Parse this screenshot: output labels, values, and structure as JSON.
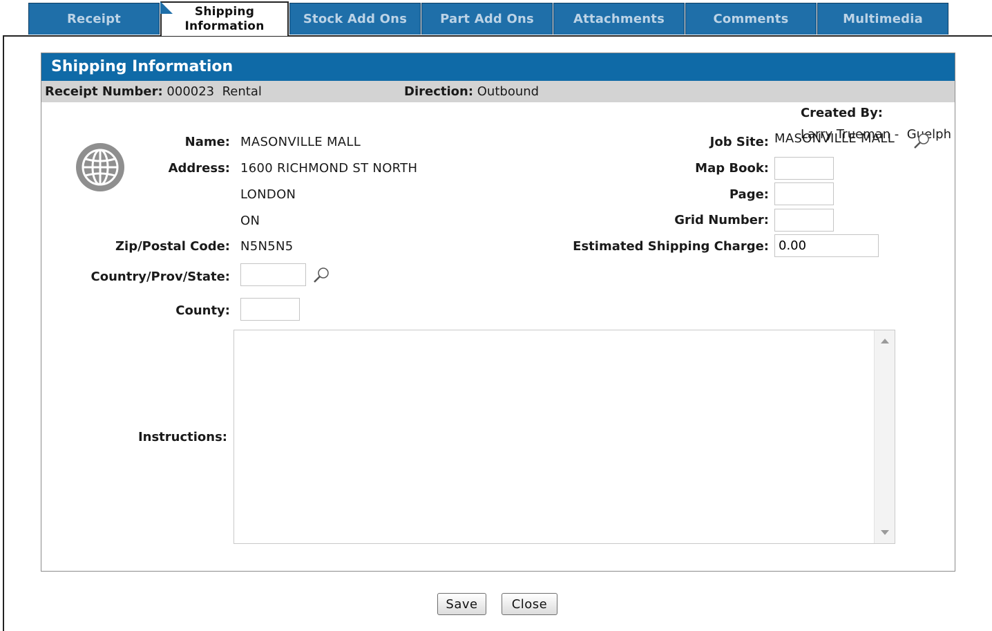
{
  "tabs": [
    {
      "label": "Receipt"
    },
    {
      "label": "Shipping Information"
    },
    {
      "label": "Stock Add Ons"
    },
    {
      "label": "Part Add Ons"
    },
    {
      "label": "Attachments"
    },
    {
      "label": "Comments"
    },
    {
      "label": "Multimedia"
    }
  ],
  "active_tab": "Shipping Information",
  "panel": {
    "title": "Shipping Information"
  },
  "infobar": {
    "receipt_label": "Receipt Number:",
    "receipt_value": "000023",
    "receipt_type": "Rental",
    "direction_label": "Direction:",
    "direction_value": "Outbound",
    "created_label": "Created By:",
    "created_value": "Larry Trueman -  Guelph"
  },
  "form": {
    "name_label": "Name:",
    "name_value": "MASONVILLE MALL",
    "address_label": "Address:",
    "address_line1": "1600 RICHMOND ST NORTH",
    "address_line2": "LONDON",
    "address_line3": "ON",
    "zip_label": "Zip/Postal Code:",
    "zip_value": "N5N5N5",
    "country_label": "Country/Prov/State:",
    "country_value": "",
    "county_label": "County:",
    "county_value": "",
    "instructions_label": "Instructions:",
    "instructions_value": "",
    "jobsite_label": "Job Site:",
    "jobsite_value": "MASONVILLE MALL",
    "mapbook_label": "Map Book:",
    "mapbook_value": "",
    "page_label": "Page:",
    "page_value": "",
    "grid_label": "Grid Number:",
    "grid_value": "",
    "shipping_label": "Estimated Shipping Charge:",
    "shipping_value": "0.00"
  },
  "buttons": {
    "save": "Save",
    "close": "Close"
  },
  "colors": {
    "tab_bg": "#1f6fa9",
    "title_bg": "#0f6aa7",
    "infobar_bg": "#d3d3d3"
  },
  "icons": {
    "globe": "globe-icon",
    "lookup": "magnifier-icon"
  }
}
